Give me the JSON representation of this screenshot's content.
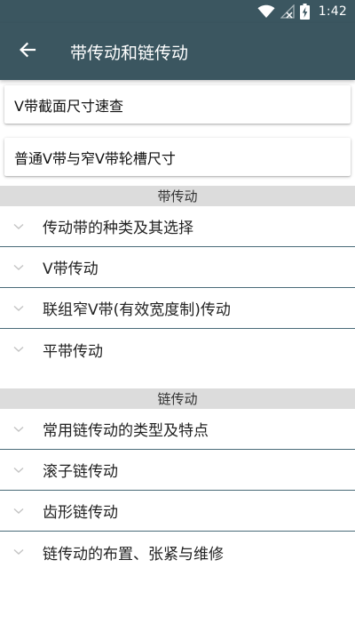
{
  "status_bar": {
    "time": "1:42",
    "icons": [
      "wifi-icon",
      "signal-icon",
      "battery-charging-icon"
    ]
  },
  "app_bar": {
    "title": "带传动和链传动",
    "back_icon": "arrow-back-icon"
  },
  "quick_links": [
    {
      "label": "V带截面尺寸速查"
    },
    {
      "label": "普通V带与窄V带轮槽尺寸"
    }
  ],
  "sections": [
    {
      "header": "带传动",
      "items": [
        {
          "label": "传动带的种类及其选择"
        },
        {
          "label": "V带传动"
        },
        {
          "label": "联组窄V带(有效宽度制)传动"
        },
        {
          "label": "平带传动"
        }
      ]
    },
    {
      "header": "链传动",
      "items": [
        {
          "label": "常用链传动的类型及特点"
        },
        {
          "label": "滚子链传动"
        },
        {
          "label": "齿形链传动"
        },
        {
          "label": "链传动的布置、张紧与维修"
        }
      ]
    }
  ],
  "colors": {
    "app_bar": "#3b5660",
    "divider": "#4a6b78",
    "section_header_bg": "#dcdcdc",
    "chevron": "#c4c4c4"
  }
}
